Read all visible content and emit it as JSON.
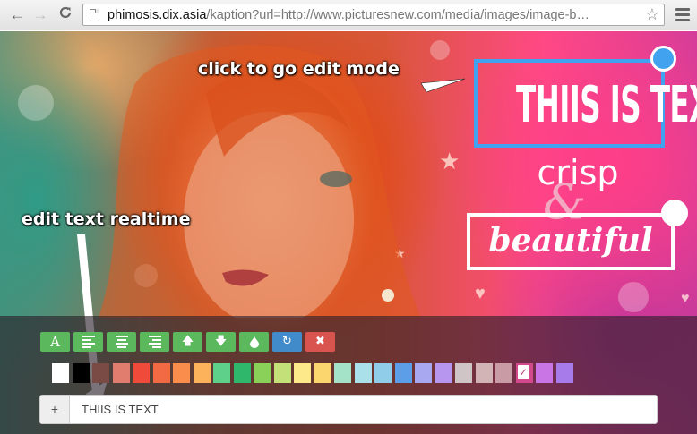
{
  "browser": {
    "back_icon": "←",
    "forward_icon": "→",
    "reload_icon": "C",
    "url_host": "phimosis.dix.asia",
    "url_rest": "/kaption?url=http://www.picturesnew.com/media/images/image-b…",
    "star_icon": "☆"
  },
  "annotations": {
    "edit_mode": "click to go edit mode",
    "realtime": "edit text realtime"
  },
  "canvas": {
    "title_text": "THIIS IS TEXT",
    "crisp_text": "crisp",
    "amp_text": "&",
    "beautiful_text": "beautiful",
    "handle_active_color": "#41a2f0",
    "handle_inactive_color": "#ffffff"
  },
  "toolbar": {
    "buttons": [
      {
        "name": "font-button",
        "icon": "font-icon",
        "label": "A",
        "color": "green"
      },
      {
        "name": "align-left-button",
        "icon": "align-left-icon",
        "label": "",
        "color": "green"
      },
      {
        "name": "align-center-button",
        "icon": "align-center-icon",
        "label": "",
        "color": "green"
      },
      {
        "name": "align-right-button",
        "icon": "align-right-icon",
        "label": "",
        "color": "green"
      },
      {
        "name": "move-up-button",
        "icon": "arrow-up-icon",
        "label": "🡅",
        "color": "green"
      },
      {
        "name": "move-down-button",
        "icon": "arrow-down-icon",
        "label": "🡇",
        "color": "green"
      },
      {
        "name": "opacity-button",
        "icon": "drop-icon",
        "label": "💧",
        "color": "green"
      },
      {
        "name": "redo-button",
        "icon": "redo-icon",
        "label": "↻",
        "color": "blue"
      },
      {
        "name": "delete-button",
        "icon": "close-icon",
        "label": "✖",
        "color": "red"
      }
    ]
  },
  "palette": {
    "colors": [
      "#ffffff",
      "#000000",
      "#7a4a45",
      "#e17d6f",
      "#ef4a3a",
      "#f26a44",
      "#fb8d4c",
      "#fbb25a",
      "#5fd08a",
      "#2fb86c",
      "#8ad15a",
      "#c4e078",
      "#fde98a",
      "#fbd56e",
      "#a4e3c8",
      "#aae0ea",
      "#8fcde8",
      "#5d9ee9",
      "#a8a8f0",
      "#b796f0",
      "#cfc4c6",
      "#d2b4b7",
      "#c99ba4",
      "#d34a8c",
      "#c975e6",
      "#a77bea"
    ],
    "selected_index": 23
  },
  "editor": {
    "add_label": "+",
    "text_value": "THIIS IS TEXT"
  }
}
